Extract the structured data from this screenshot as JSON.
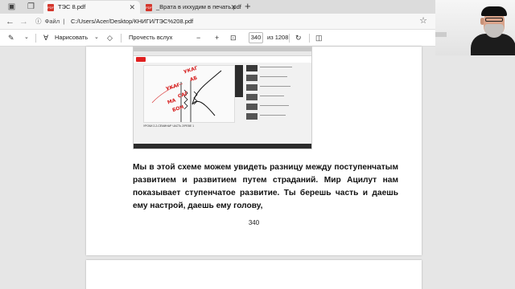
{
  "tabs": [
    {
      "title": "ТЭС 8.pdf",
      "active": true
    },
    {
      "title": "_Врата в иххудим в печать.pdf",
      "active": false
    }
  ],
  "address_bar": {
    "site_label": "Файл",
    "url": "C:/Users/Acer/Desktop/КНИГИ/ТЭС%208.pdf"
  },
  "pdf_toolbar": {
    "draw_label": "Нарисовать",
    "read_aloud_label": "Прочесть вслух",
    "zoom_out": "−",
    "zoom_in": "+",
    "current_page": "340",
    "page_total": "из 1208"
  },
  "document": {
    "paragraph": "Мы в этой схеме можем увидеть разницу между поступенчатым развитием и развитием путем страданий. Мир Ацилут нам показывает ступенчатое развитие. Ты берешь часть и даешь ему настрой, даешь ему голову,",
    "page_number": "340",
    "embedded_image": {
      "video_title": "УРОКИ 2-2-СЕМИНАР ЧАСТЬ 2/РЕВЕ 1",
      "handwritten": [
        "УКАГ",
        "АБ",
        "УКАГ",
        "САГ",
        "МА",
        "БОН"
      ]
    }
  },
  "colors": {
    "pdf_red": "#d4362c",
    "accent": "#d62020"
  }
}
